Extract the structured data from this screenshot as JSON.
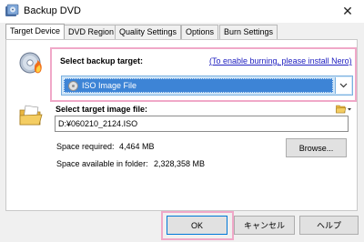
{
  "window": {
    "title": "Backup DVD",
    "close_glyph": "✕"
  },
  "tabs": [
    {
      "label": "Target Device",
      "active": true
    },
    {
      "label": "DVD Region",
      "active": false
    },
    {
      "label": "Quality Settings",
      "active": false
    },
    {
      "label": "Options",
      "active": false
    },
    {
      "label": "Burn Settings",
      "active": false
    }
  ],
  "target": {
    "label": "Select backup target:",
    "link": "(To enable burning, please install Nero)",
    "selected": "ISO Image File",
    "icon": "cd-burn-icon"
  },
  "file": {
    "label": "Select target image file:",
    "value": "D:¥060210_2124.ISO",
    "browse_label": "Browse...",
    "icon": "folder-icon",
    "space_required_label": "Space required:",
    "space_required_value": "4,464 MB",
    "space_available_label": "Space available in folder:",
    "space_available_value": "2,328,358 MB"
  },
  "footer": {
    "ok": "OK",
    "cancel": "キャンセル",
    "help": "ヘルプ"
  },
  "colors": {
    "highlight": "#f0a8c8",
    "selection": "#3d84d6",
    "link": "#2020c0"
  }
}
